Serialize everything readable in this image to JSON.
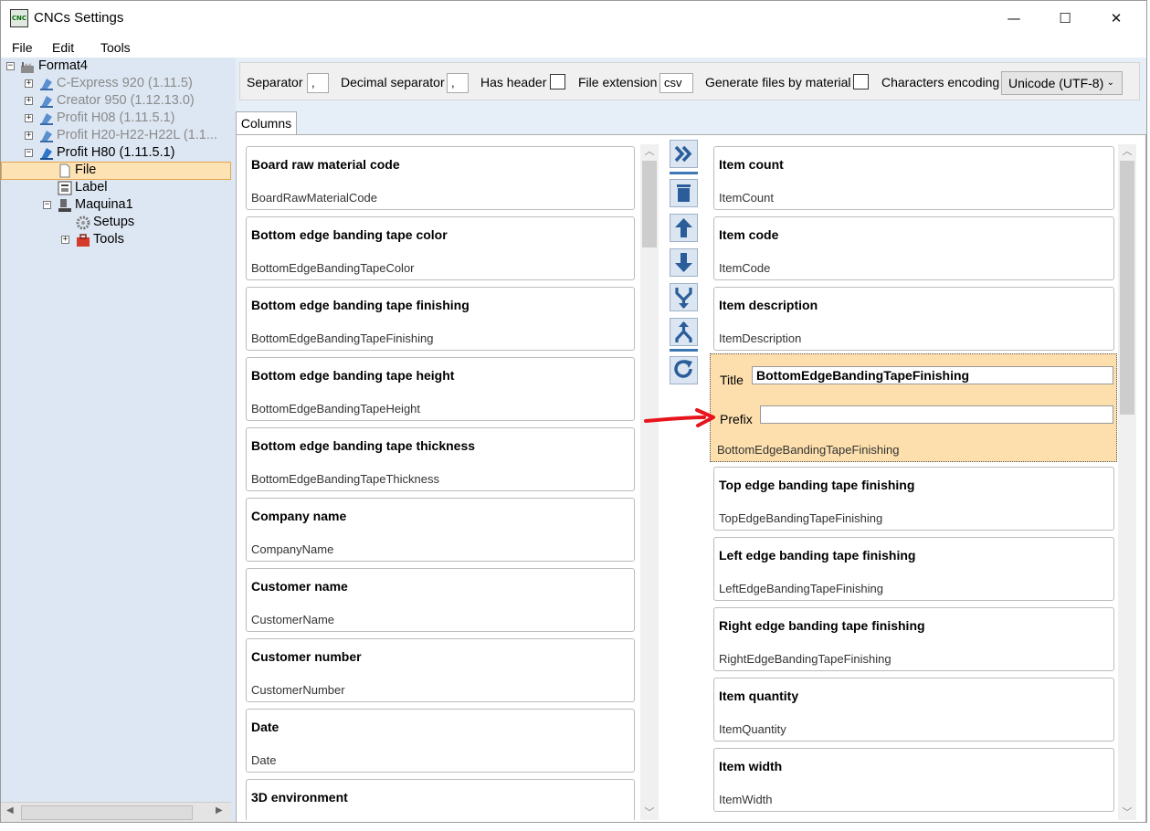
{
  "window": {
    "title": "CNCs Settings",
    "app_icon": "CNC",
    "minimize_glyph": "—",
    "maximize_glyph": "☐",
    "close_glyph": "✕"
  },
  "menu": [
    "File",
    "Edit",
    "Tools"
  ],
  "tree": {
    "root": "Format4",
    "machines": [
      {
        "label": "C-Express 920 (1.11.5)",
        "disabled": true
      },
      {
        "label": "Creator 950 (1.12.13.0)",
        "disabled": true
      },
      {
        "label": "Profit H08 (1.11.5.1)",
        "disabled": true
      },
      {
        "label": "Profit  H20-H22-H22L  (1.1...",
        "disabled": true
      },
      {
        "label": "Profit H80 (1.11.5.1)",
        "disabled": false
      }
    ],
    "children": [
      "File",
      "Label",
      "Maquina1",
      "Setups",
      "Tools"
    ]
  },
  "options": {
    "separator_label": "Separator",
    "separator_value": ",",
    "decimal_label": "Decimal separator",
    "decimal_value": ",",
    "has_header_label": "Has header",
    "file_ext_label": "File extension",
    "file_ext_value": "csv",
    "gen_by_material_label": "Generate files by material",
    "encoding_label": "Characters encoding",
    "encoding_value": "Unicode (UTF-8)"
  },
  "tab_label": "Columns",
  "available_columns": [
    {
      "title": "Board raw material code",
      "key": "BoardRawMaterialCode"
    },
    {
      "title": "Bottom edge banding tape color",
      "key": "BottomEdgeBandingTapeColor"
    },
    {
      "title": "Bottom edge banding tape finishing",
      "key": "BottomEdgeBandingTapeFinishing"
    },
    {
      "title": "Bottom edge banding tape height",
      "key": "BottomEdgeBandingTapeHeight"
    },
    {
      "title": "Bottom edge banding tape thickness",
      "key": "BottomEdgeBandingTapeThickness"
    },
    {
      "title": "Company name",
      "key": "CompanyName"
    },
    {
      "title": "Customer name",
      "key": "CustomerName"
    },
    {
      "title": "Customer number",
      "key": "CustomerNumber"
    },
    {
      "title": "Date",
      "key": "Date"
    },
    {
      "title": "3D environment",
      "key": ""
    }
  ],
  "selected_columns": [
    {
      "title": "Item count",
      "key": "ItemCount"
    },
    {
      "title": "Item code",
      "key": "ItemCode"
    },
    {
      "title": "Item description",
      "key": "ItemDescription"
    }
  ],
  "edited_column": {
    "title_label": "Title",
    "title_value": "BottomEdgeBandingTapeFinishing",
    "prefix_label": "Prefix",
    "prefix_value": "",
    "key": "BottomEdgeBandingTapeFinishing"
  },
  "selected_columns_after": [
    {
      "title": "Top edge banding tape finishing",
      "key": "TopEdgeBandingTapeFinishing"
    },
    {
      "title": "Left edge banding tape finishing",
      "key": "LeftEdgeBandingTapeFinishing"
    },
    {
      "title": "Right edge banding tape finishing",
      "key": "RightEdgeBandingTapeFinishing"
    },
    {
      "title": "Item quantity",
      "key": "ItemQuantity"
    },
    {
      "title": "Item width",
      "key": "ItemWidth"
    }
  ],
  "action_buttons": [
    "add-all-icon",
    "delete-icon",
    "move-up-icon",
    "move-down-icon",
    "merge-icon",
    "split-icon",
    "refresh-icon"
  ],
  "colors": {
    "selection": "#fde3b4",
    "edit_card": "#fddfad",
    "tree_bg": "#dde7f3",
    "accent": "#3d6fa8",
    "annotation_arrow": "#e8141b"
  }
}
